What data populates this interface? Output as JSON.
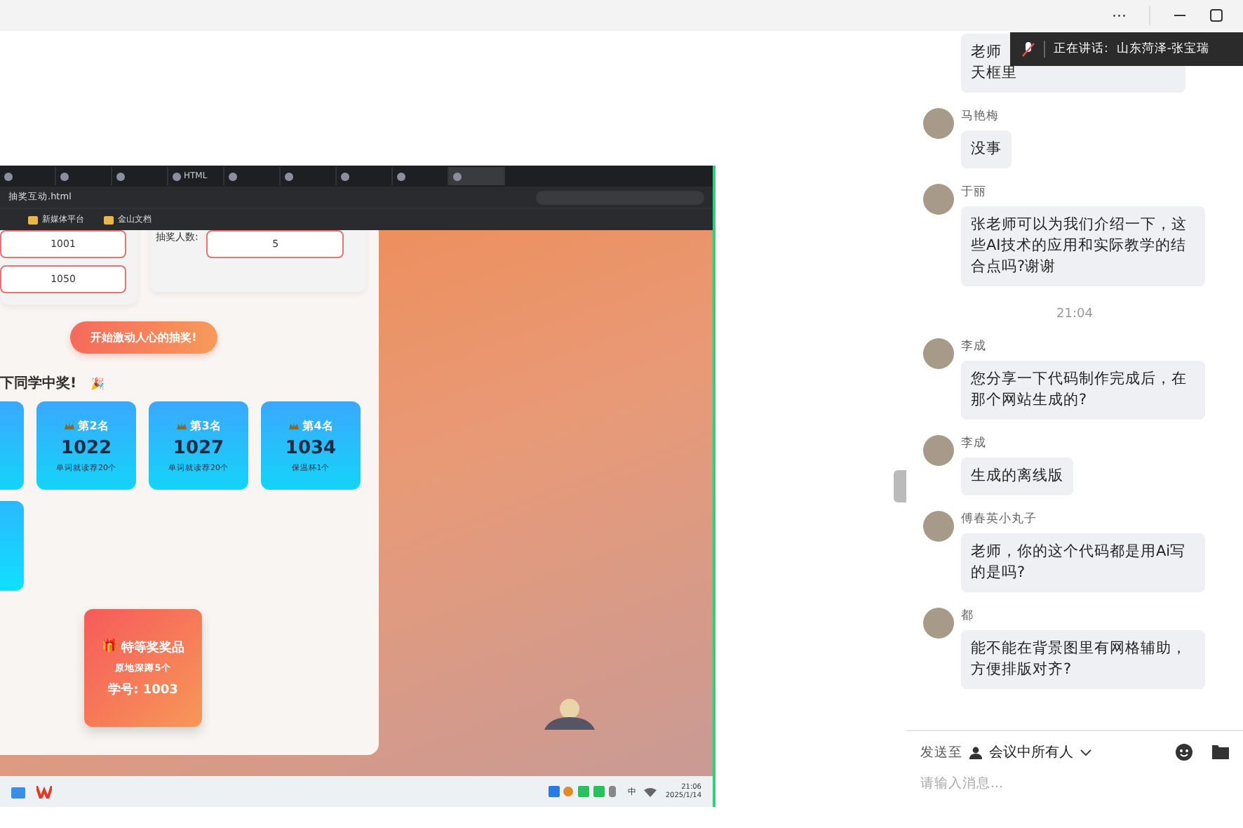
{
  "window": {
    "more": "···"
  },
  "speaking_banner": {
    "label": "正在讲话:",
    "speaker": "山东菏泽-张宝瑞"
  },
  "shared_screen": {
    "browser": {
      "tabs": [
        {
          "selected": false
        },
        {
          "selected": false
        },
        {
          "selected": false
        },
        {
          "label": "HTML",
          "selected": false
        },
        {
          "selected": false
        },
        {
          "selected": false
        },
        {
          "selected": false
        },
        {
          "selected": false
        },
        {
          "selected": true
        }
      ],
      "address": "抽奖互动.html",
      "bookmarks": [
        "新媒体平台",
        "金山文档"
      ]
    },
    "page": {
      "range_inputs": [
        "1001",
        "1050"
      ],
      "count_label": "抽奖人数:",
      "count_value": "5",
      "start_button": "开始激动人心的抽奖!",
      "winners_heading": "下同学中奖!",
      "heading_emoji": "🎉",
      "winners": [
        {
          "rank": "第2名",
          "number": "1022",
          "prize": "单词就读荐20个"
        },
        {
          "rank": "第3名",
          "number": "1027",
          "prize": "单词就读荐20个"
        },
        {
          "rank": "第4名",
          "number": "1034",
          "prize": "保温杯1个"
        }
      ],
      "special": {
        "title": "特等奖奖品",
        "emoji": "🎁",
        "prize": "原地深蹲5个",
        "number": "学号: 1003"
      }
    },
    "taskbar": {
      "ime": "中",
      "time": "21:06",
      "date": "2025/1/14"
    }
  },
  "chat": {
    "items": [
      {
        "kind": "partial",
        "lines": [
          "老师",
          "天框里"
        ]
      },
      {
        "kind": "message",
        "name": "马艳梅",
        "text": "没事"
      },
      {
        "kind": "message",
        "name": "于丽",
        "text": "张老师可以为我们介绍一下，这些AI技术的应用和实际教学的结合点吗?谢谢"
      },
      {
        "kind": "time",
        "text": "21:04"
      },
      {
        "kind": "message",
        "name": "李成",
        "text": "您分享一下代码制作完成后，在那个网站生成的?"
      },
      {
        "kind": "message",
        "name": "李成",
        "text": "生成的离线版"
      },
      {
        "kind": "message",
        "name": "傅春英小丸子",
        "text": "老师，你的这个代码都是用Ai写的是吗?"
      },
      {
        "kind": "message",
        "name": "都",
        "text": "能不能在背景图里有网格辅助，方便排版对齐?"
      }
    ],
    "send_to_label": "发送至",
    "recipient": "会议中所有人",
    "placeholder": "请输入消息..."
  }
}
